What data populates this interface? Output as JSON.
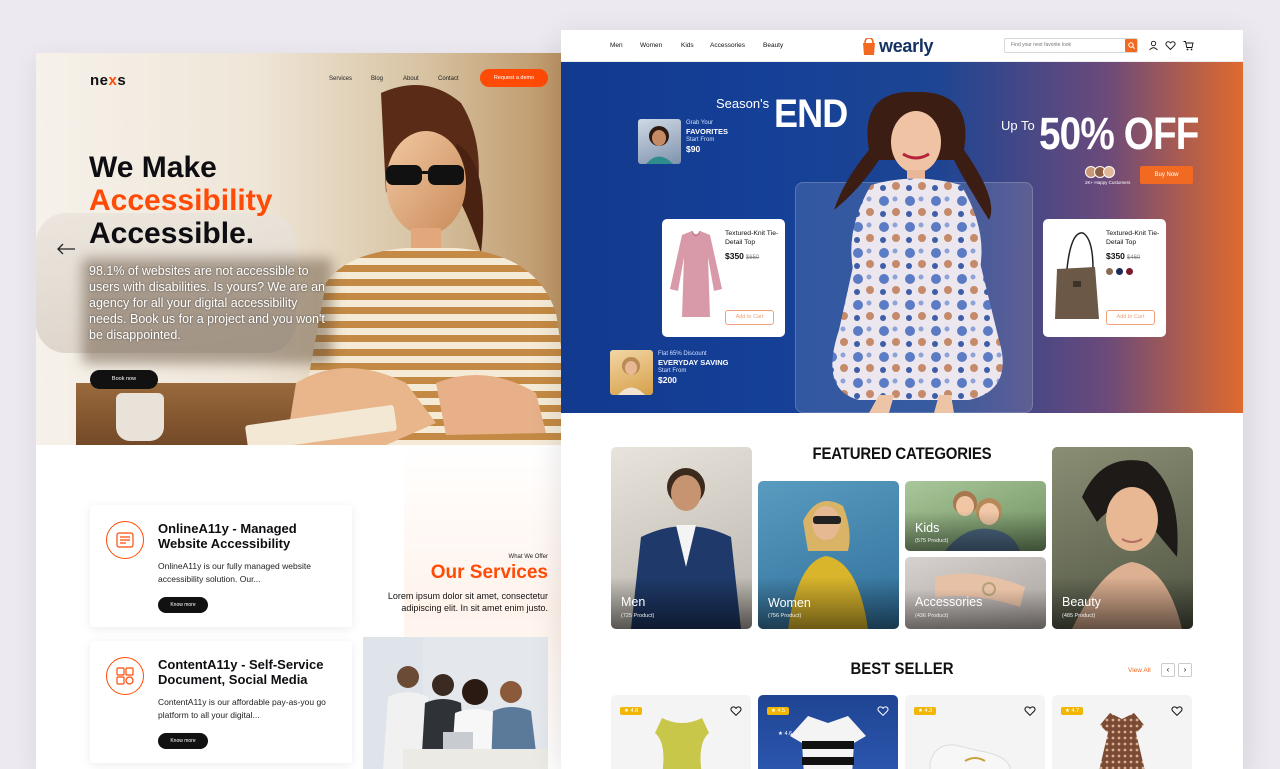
{
  "nexs": {
    "logo_pre": "ne",
    "logo_x": "x",
    "logo_post": "s",
    "nav": [
      "Services",
      "Blog",
      "About",
      "Contact"
    ],
    "cta": "Request a demo",
    "hero_line1": "We Make",
    "hero_line2": "Accessibility",
    "hero_line3": "Accessible.",
    "hero_paragraph": "98.1% of websites are not accessible to users with disabilities. Is yours? We are an agency for all your digital accessibility needs. Book us for a project and you won't be disappointed.",
    "book_button": "Book now",
    "services_tag": "What We Offer",
    "services_title": "Our Services",
    "services_desc": "Lorem ipsum dolor sit amet, consectetur adipiscing elit. In sit amet enim justo.",
    "cards": [
      {
        "title": "OnlineA11y - Managed Website Accessibility",
        "desc": "OnlineA11y is our fully managed website accessibility solution. Our...",
        "button": "Know more"
      },
      {
        "title": "ContentA11y - Self-Service Document, Social Media",
        "desc": "ContentA11y is our affordable pay-as-you go platform to all your digital...",
        "button": "Know more"
      }
    ],
    "colors": {
      "accent": "#ff4b05",
      "dark": "#0e0e12"
    }
  },
  "wearly": {
    "nav": [
      "Men",
      "Women",
      "Kids",
      "Accessories",
      "Beauty"
    ],
    "logo": "wearly",
    "search_placeholder": "Find your next favorite look",
    "hero": {
      "season": "Season's",
      "end": "END",
      "up_to": "Up To",
      "discount": "50% OFF",
      "happy": "2K+ Happy Customers",
      "buy": "Buy Now",
      "mini1": {
        "line1": "Grab Your",
        "line2": "FAVORITES",
        "line3": "Start From",
        "price": "$90"
      },
      "mini2": {
        "line1": "Flat 65% Discount",
        "line2": "EVERYDAY SAVING",
        "line3": "Start From",
        "price": "$200"
      },
      "product1": {
        "name": "Textured-Knit Tie-Detail Top",
        "price": "$350",
        "old": "$650",
        "cart": "Add to Cart"
      },
      "product2": {
        "name": "Textured-Knit Tie-Detail Top",
        "price": "$350",
        "old": "$460",
        "cart": "Add to Cart"
      }
    },
    "featured_title": "FEATURED CATEGORIES",
    "categories": [
      {
        "label": "Men",
        "count": "(725 Product)"
      },
      {
        "label": "Women",
        "count": "(756 Product)"
      },
      {
        "label": "Kids",
        "count": "(575 Product)"
      },
      {
        "label": "Accessories",
        "count": "(436 Product)"
      },
      {
        "label": "Beauty",
        "count": "(485 Product)"
      }
    ],
    "best_title": "BEST SELLER",
    "view_all": "View All",
    "best": [
      {
        "rating": "★ 4.8"
      },
      {
        "rating": "★ 4.5",
        "rating2": "★ 4.6"
      },
      {
        "rating": "★ 4.3"
      },
      {
        "rating": "★ 4.7"
      }
    ],
    "colors": {
      "brand": "#14315f",
      "accent": "#f26a22",
      "hero_blue": "#154097"
    }
  }
}
